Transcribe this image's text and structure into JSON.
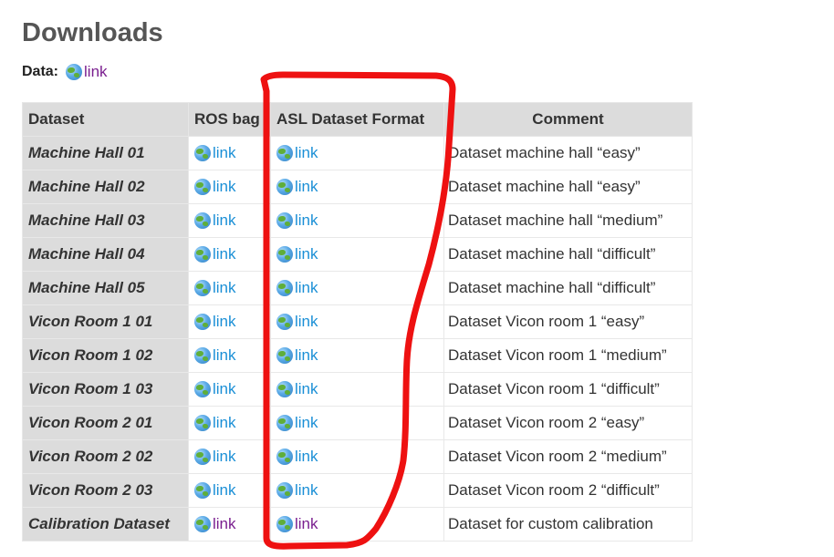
{
  "page": {
    "title": "Downloads",
    "data_label": "Data:",
    "data_link": "link"
  },
  "table": {
    "headers": [
      "Dataset",
      "ROS bag",
      "ASL Dataset Format",
      "Comment"
    ],
    "rows": [
      {
        "name": "Machine Hall 01",
        "ros": "link",
        "asl": "link",
        "comment": "Dataset machine hall “easy”"
      },
      {
        "name": "Machine Hall 02",
        "ros": "link",
        "asl": "link",
        "comment": "Dataset machine hall “easy”"
      },
      {
        "name": "Machine Hall 03",
        "ros": "link",
        "asl": "link",
        "comment": "Dataset machine hall “medium”"
      },
      {
        "name": "Machine Hall 04",
        "ros": "link",
        "asl": "link",
        "comment": "Dataset machine hall “difficult”"
      },
      {
        "name": "Machine Hall 05",
        "ros": "link",
        "asl": "link",
        "comment": "Dataset machine hall “difficult”"
      },
      {
        "name": "Vicon Room 1 01",
        "ros": "link",
        "asl": "link",
        "comment": "Dataset Vicon room 1 “easy”"
      },
      {
        "name": "Vicon Room 1 02",
        "ros": "link",
        "asl": "link",
        "comment": "Dataset Vicon room 1 “medium”"
      },
      {
        "name": "Vicon Room 1 03",
        "ros": "link",
        "asl": "link",
        "comment": "Dataset Vicon room 1 “difficult”"
      },
      {
        "name": "Vicon Room 2 01",
        "ros": "link",
        "asl": "link",
        "comment": "Dataset Vicon room 2 “easy”"
      },
      {
        "name": "Vicon Room 2 02",
        "ros": "link",
        "asl": "link",
        "comment": "Dataset Vicon room 2 “medium”"
      },
      {
        "name": "Vicon Room 2 03",
        "ros": "link",
        "asl": "link",
        "comment": "Dataset Vicon room 2 “difficult”"
      },
      {
        "name": "Calibration Dataset",
        "ros": "link",
        "asl": "link",
        "comment": "Dataset for custom calibration"
      }
    ]
  },
  "colors": {
    "link_unvisited": "#1a8fd6",
    "link_visited": "#7a1f8f",
    "header_bg": "#dcdcdc",
    "annotation_red": "#ee1111"
  },
  "icons": {
    "link_icon": "globe-icon"
  }
}
